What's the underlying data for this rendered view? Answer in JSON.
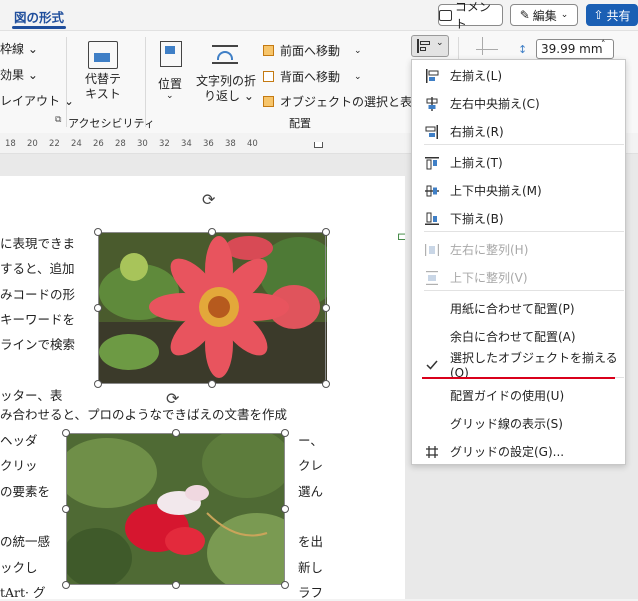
{
  "tab": {
    "label": "図の形式"
  },
  "topbar": {
    "comment": "コメント",
    "edit": "編集",
    "share": "共有"
  },
  "ribbon": {
    "left_items": [
      "枠線",
      "効果",
      "レイアウト"
    ],
    "alt_text": [
      "代替テ",
      "キスト"
    ],
    "accessibility_group": "アクセシビリティ",
    "position": "位置",
    "wrap_text": [
      "文字列の折",
      "り返し"
    ],
    "bring_forward": "前面へ移動",
    "send_backward": "背面へ移動",
    "selection_pane": "オブジェクトの選択と表示",
    "arrange_group": "配置",
    "width_value": "39.99 mm"
  },
  "ruler": {
    "ticks": [
      "18",
      "20",
      "22",
      "24",
      "26",
      "28",
      "30",
      "32",
      "34",
      "36",
      "38",
      "40"
    ]
  },
  "document": {
    "lines_left": [
      "に表現できま",
      "すると、追加",
      "みコードの形",
      "キーワードを",
      "ラインで検索",
      "",
      "ッター、表"
    ],
    "full_line": "み合わせると、プロのようなできばえの文書を作成",
    "lines_left2": [
      "ヘッダ",
      "クリッ",
      "の要素を",
      "",
      "の統一感",
      "ックし",
      "tArt· グ"
    ],
    "lines_right2": [
      "ー、",
      "クレ",
      "選ん",
      "",
      "を出",
      "新し",
      "ラフ"
    ]
  },
  "menu": {
    "items": [
      {
        "label": "左揃え(L)",
        "icon": "align-left-icon",
        "disabled": false
      },
      {
        "label": "左右中央揃え(C)",
        "icon": "align-center-icon",
        "disabled": false
      },
      {
        "label": "右揃え(R)",
        "icon": "align-right-icon",
        "disabled": false
      },
      {
        "label": "上揃え(T)",
        "icon": "align-top-icon",
        "disabled": false
      },
      {
        "label": "上下中央揃え(M)",
        "icon": "align-middle-icon",
        "disabled": false
      },
      {
        "label": "下揃え(B)",
        "icon": "align-bottom-icon",
        "disabled": false
      },
      {
        "label": "左右に整列(H)",
        "icon": "distribute-horizontal-icon",
        "disabled": true
      },
      {
        "label": "上下に整列(V)",
        "icon": "distribute-vertical-icon",
        "disabled": true
      },
      {
        "label": "用紙に合わせて配置(P)",
        "icon": "",
        "disabled": false
      },
      {
        "label": "余白に合わせて配置(A)",
        "icon": "",
        "disabled": false
      },
      {
        "label": "選択したオブジェクトを揃える(O)",
        "icon": "checkmark-icon",
        "disabled": false
      },
      {
        "label": "配置ガイドの使用(U)",
        "icon": "",
        "disabled": false
      },
      {
        "label": "グリッド線の表示(S)",
        "icon": "",
        "disabled": false
      },
      {
        "label": "グリッドの設定(G)...",
        "icon": "grid-icon",
        "disabled": false
      }
    ]
  },
  "colors": {
    "accent": "#1f4e9c",
    "share": "#1a5fb4",
    "underline": "#d9001b"
  }
}
